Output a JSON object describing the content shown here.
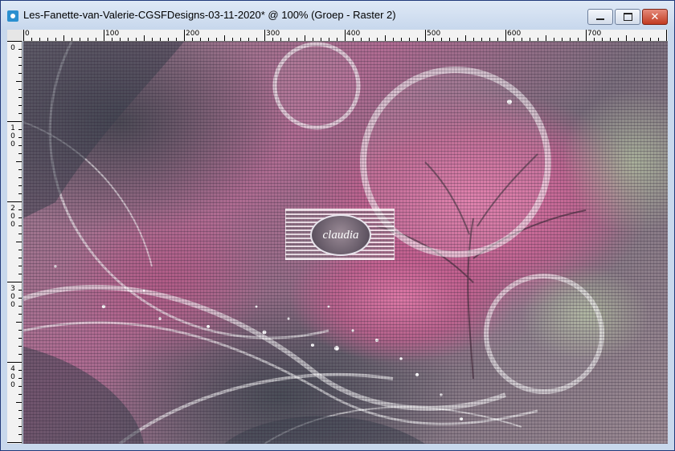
{
  "window": {
    "title": "Les-Fanette-van-Valerie-CGSFDesigns-03-11-2020* @ 100% (Groep - Raster 2)",
    "controls": {
      "minimize": "minimize",
      "maximize": "maximize",
      "close": "✕"
    }
  },
  "ruler": {
    "top": [
      "0",
      "100",
      "200",
      "300",
      "400",
      "500",
      "600",
      "700"
    ],
    "left": [
      "0",
      "100",
      "200",
      "300",
      "400"
    ]
  },
  "canvas": {
    "watermark": "claudia"
  },
  "colors": {
    "accent_pink": "#c26a9a",
    "dark_gray": "#4c4a55",
    "close_red": "#c23b22",
    "title_bar": "#c7d7ec"
  }
}
